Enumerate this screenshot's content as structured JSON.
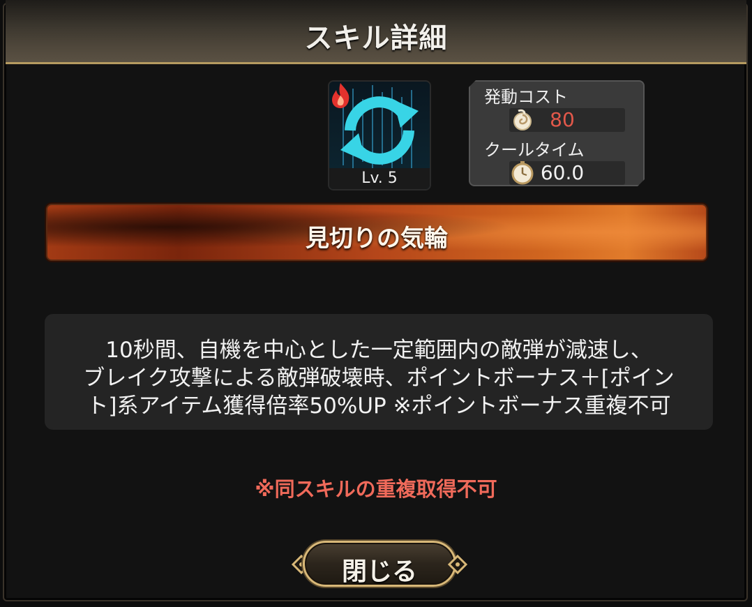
{
  "dialog": {
    "title": "スキル詳細"
  },
  "skill": {
    "level_label": "Lv. 5",
    "name": "見切りの気輪",
    "icon": "refresh-arrows-icon",
    "element_icon": "fire-icon",
    "description_lines": [
      "10秒間、自機を中心とした一定範囲内の敵弾が減速し、",
      "ブレイク攻撃による敵弾破壊時、ポイントボーナス＋[ポイン",
      "ト]系アイテム獲得倍率50%UP ※ポイントボーナス重複不可"
    ],
    "warning": "※同スキルの重複取得不可"
  },
  "stats": {
    "cost_label": "発動コスト",
    "cost_value": "80",
    "cost_icon": "swirl-cost-icon",
    "cooltime_label": "クールタイム",
    "cooltime_value": "60.0",
    "cooltime_icon": "stopwatch-icon"
  },
  "buttons": {
    "close_label": "閉じる"
  },
  "colors": {
    "accent_gold": "#d8b878",
    "cost_red": "#e2584a",
    "warning_red": "#f06a5a",
    "icon_cyan": "#38d4e6"
  }
}
